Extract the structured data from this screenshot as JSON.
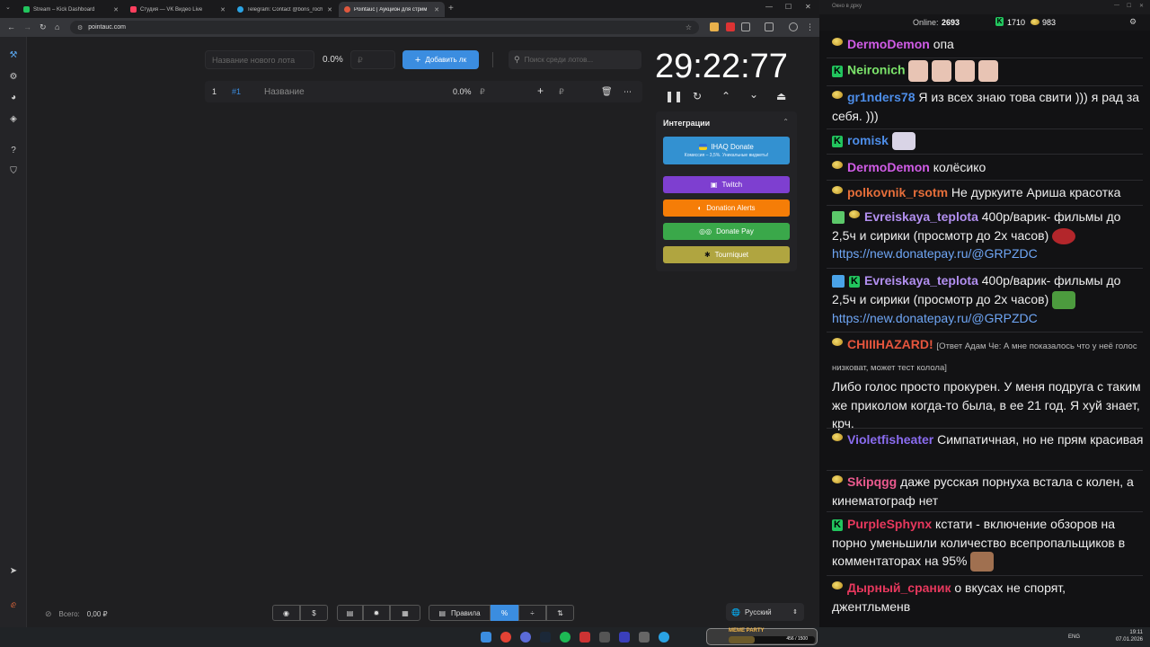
{
  "browser": {
    "tabs": [
      {
        "title": "Stream – Kick Dashboard",
        "icon": "kick-icon",
        "color": "#22c55e"
      },
      {
        "title": "Студия — VK Видео Live",
        "icon": "vk-icon",
        "color": "#ff3f5e"
      },
      {
        "title": "Telegram: Contact @boris_roch",
        "icon": "telegram-icon",
        "color": "#2aa3e4"
      },
      {
        "title": "Pointauc | Аукцион для стрим",
        "icon": "pointauc-icon",
        "color": "#e0583e",
        "active": true
      }
    ],
    "url": "pointauc.com"
  },
  "auction": {
    "new_lot_placeholder": "Название нового лота",
    "new_lot_percent": "0.0%",
    "amount_placeholder": "₽",
    "add_button": "Добавить лк",
    "search_placeholder": "Поиск среди лотов...",
    "lots": [
      {
        "index": "1",
        "id": "#1",
        "name": "Название",
        "percent": "0.0%",
        "currency": "₽",
        "amount_currency": "₽"
      }
    ],
    "timer": "29:22:77",
    "total_label": "Всего:",
    "total_value": "0,00 ₽"
  },
  "integrations": {
    "title": "Интеграции",
    "buttons": [
      {
        "label": "IHAQ Donate",
        "sub": "Комиссия – 3,5%. Уникальные виджеты!",
        "color": "#3391d1"
      },
      {
        "label": "Twitch",
        "color": "#7e3fd0"
      },
      {
        "label": "Donation Alerts",
        "color": "#f57d07"
      },
      {
        "label": "Donate Pay",
        "color": "#3aa84a"
      },
      {
        "label": "Tourniquet",
        "color": "#b0a540"
      }
    ]
  },
  "bottom_bar": {
    "rules_label": "Правила",
    "language": "Русский"
  },
  "chat": {
    "window_title": "Окно в дрку",
    "online_label": "Online:",
    "online_count": "2693",
    "kick_count": "1710",
    "lemon_count": "983",
    "messages": [
      {
        "user": "DermoDemon",
        "color": "#d05ce6",
        "badge": "lemon",
        "text": "опа"
      },
      {
        "user": "Neironich",
        "color": "#7be36a",
        "badge": "kick",
        "text": ""
      },
      {
        "user": "gr1nders78",
        "color": "#4d8de8",
        "badge": "lemon",
        "text": "Я из всех знаю това свити ))) я рад за себя. )))"
      },
      {
        "user": "romisk",
        "color": "#4d8de8",
        "badge": "kick",
        "text": ""
      },
      {
        "user": "DermoDemon",
        "color": "#d05ce6",
        "badge": "lemon",
        "text": "колёсико"
      },
      {
        "user": "polkovnik_rsotm",
        "color": "#e56e3a",
        "badge": "lemon",
        "text": "Не дуркуите Ариша красотка"
      },
      {
        "user": "Evreiskaya_teplota",
        "color": "#b28ff0",
        "badge": "lemon",
        "text": "400р/варик- фильмы до 2,5ч и сирики (просмотр до 2х часов)",
        "link": "https://new.donatepay.ru/@GRPZDC"
      },
      {
        "user": "Evreiskaya_teplota",
        "color": "#b28ff0",
        "badge": "kick",
        "text": "400р/варик- фильмы до 2,5ч и сирики (просмотр до 2х часов)",
        "link": "https://new.donatepay.ru/@GRPZDC"
      },
      {
        "user": "CHIIIHAZARD!",
        "color": "#e5553d",
        "badge": "lemon",
        "quote": "[Ответ Адам Че: А мне показалось что у неё голос низковат, может тест колола]",
        "text": "Либо голос просто прокурен. У меня подруга с таким же приколом когда-то была, в ее 21 год. Я хуй знает, крч."
      },
      {
        "user": "Violetfisheater",
        "color": "#8a6cf0",
        "badge": "lemon",
        "text": "Симпатичная, но не прям красивая"
      },
      {
        "user": "Skipqgg",
        "color": "#ea5a8e",
        "badge": "lemon",
        "text": "даже русская порнуха встала с колен, а кинематограф нет"
      },
      {
        "user": "PurpleSphynx",
        "color": "#e6385d",
        "badge": "kick",
        "text": "кстати - включение обзоров на порно уменьшили количество всепропальщиков в комментаторах на 95%"
      },
      {
        "user": "Дырный_сраник",
        "color": "#e6385d",
        "badge": "lemon",
        "text": "о вкусах не спорят, джентльменв"
      }
    ]
  },
  "taskbar": {
    "meme_label": "MEME PARTY",
    "meme_progress": "456 / 1500",
    "lang": "ENG",
    "time": "19:11",
    "date": "07.01.2026"
  }
}
